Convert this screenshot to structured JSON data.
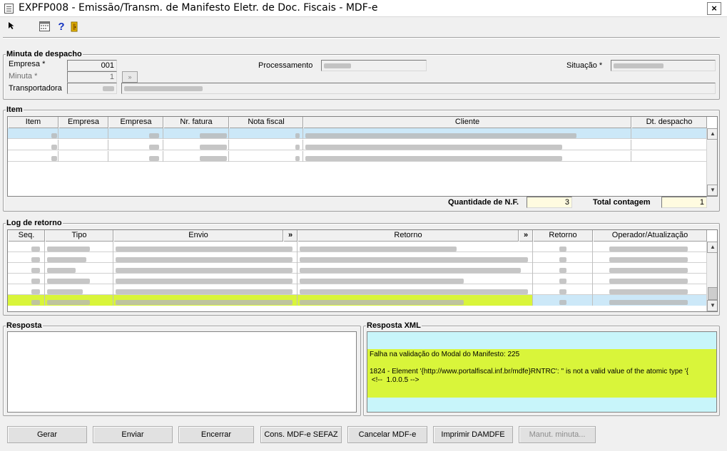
{
  "window": {
    "title": "EXPFP008 - Emissão/Transm. de Manifesto Eletr. de Doc. Fiscais - MDF-e",
    "close": "×"
  },
  "toolbar": {
    "icons": [
      "cursor-icon",
      "calendar-icon",
      "help-icon",
      "exit-door-icon"
    ],
    "help_glyph": "?"
  },
  "minuta": {
    "title": "Minuta de despacho",
    "empresa_label": "Empresa *",
    "empresa_value": "001",
    "minuta_label": "Minuta *",
    "minuta_value": "1",
    "lookup_glyph": "»",
    "transportadora_label": "Transportadora",
    "processamento_label": "Processamento",
    "situacao_label": "Situação *"
  },
  "item": {
    "title": "Item",
    "columns": [
      "Item",
      "Empresa",
      "Empresa",
      "Nr. fatura",
      "Nota fiscal",
      "Cliente",
      "Dt. despacho"
    ],
    "rows": 3,
    "quantidade_label": "Quantidade de N.F.",
    "quantidade_value": "3",
    "total_label": "Total contagem",
    "total_value": "1"
  },
  "log": {
    "title": "Log de retorno",
    "columns": [
      "Seq.",
      "Tipo",
      "Envio",
      "»",
      "Retorno",
      "»",
      "Retorno",
      "Operador/Atualização"
    ],
    "rows": 6,
    "highlight_color": "#d9f53a"
  },
  "resposta": {
    "title": "Resposta"
  },
  "resposta_xml": {
    "title": "Resposta XML",
    "line1": "Falha na validação do Modal do Manifesto: 225",
    "line2": "1824 - Element '{http://www.portalfiscal.inf.br/mdfe}RNTRC': '' is not a valid value of the atomic type '{",
    "line3": " <!--  1.0.0.5 -->",
    "bg_color": "#c8f5fa"
  },
  "buttons": {
    "gerar": "Gerar",
    "enviar": "Enviar",
    "encerrar": "Encerrar",
    "cons": "Cons. MDF-e SEFAZ",
    "cancelar": "Cancelar MDF-e",
    "imprimir": "Imprimir DAMDFE",
    "manut": "Manut. minuta..."
  }
}
